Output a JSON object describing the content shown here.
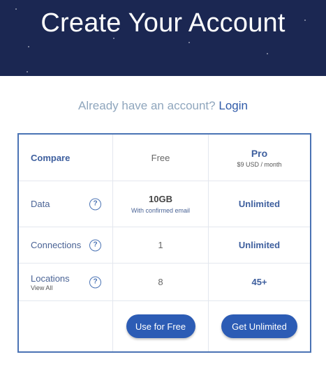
{
  "header": {
    "title": "Create Your Account"
  },
  "login_prompt": {
    "text": "Already have an account?",
    "link": "Login"
  },
  "table": {
    "headers": {
      "compare": "Compare",
      "free": "Free",
      "pro_name": "Pro",
      "pro_price": "$9 USD / month"
    },
    "rows": [
      {
        "label": "Data",
        "free_value": "10GB",
        "free_note": "With confirmed email",
        "pro_value": "Unlimited"
      },
      {
        "label": "Connections",
        "free_value": "1",
        "pro_value": "Unlimited"
      },
      {
        "label": "Locations",
        "sub_link": "View All",
        "free_value": "8",
        "pro_value": "45+"
      }
    ],
    "help_icon_glyph": "?",
    "buttons": {
      "free": "Use for Free",
      "pro": "Get Unlimited"
    }
  },
  "colors": {
    "hero_bg": "#1b2752",
    "accent": "#2c5cb5",
    "border": "#4a73b4"
  }
}
